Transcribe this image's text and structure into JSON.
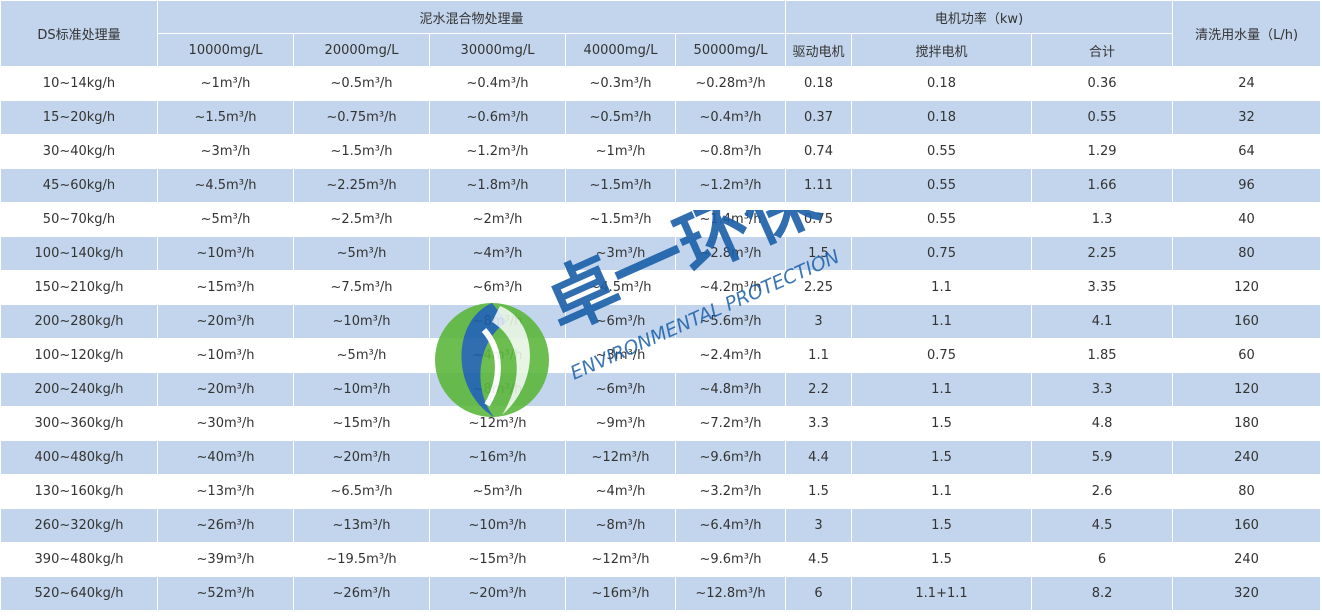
{
  "header": {
    "ds_label": "DS标准处理量",
    "mixture_label": "泥水混合物处理量",
    "motor_label": "电机功率（kw)",
    "wash_label": "清洗用水量（L/h)",
    "concentrations": [
      "10000mg/L",
      "20000mg/L",
      "30000mg/L",
      "40000mg/L",
      "50000mg/L"
    ],
    "motor_columns": [
      "驱动电机",
      "搅拌电机",
      "合计"
    ]
  },
  "rows": [
    [
      "10~14kg/h",
      "~1m³/h",
      "~0.5m³/h",
      "~0.4m³/h",
      "~0.3m³/h",
      "~0.28m³/h",
      "0.18",
      "0.18",
      "0.36",
      "24"
    ],
    [
      "15~20kg/h",
      "~1.5m³/h",
      "~0.75m³/h",
      "~0.6m³/h",
      "~0.5m³/h",
      "~0.4m³/h",
      "0.37",
      "0.18",
      "0.55",
      "32"
    ],
    [
      "30~40kg/h",
      "~3m³/h",
      "~1.5m³/h",
      "~1.2m³/h",
      "~1m³/h",
      "~0.8m³/h",
      "0.74",
      "0.55",
      "1.29",
      "64"
    ],
    [
      "45~60kg/h",
      "~4.5m³/h",
      "~2.25m³/h",
      "~1.8m³/h",
      "~1.5m³/h",
      "~1.2m³/h",
      "1.11",
      "0.55",
      "1.66",
      "96"
    ],
    [
      "50~70kg/h",
      "~5m³/h",
      "~2.5m³/h",
      "~2m³/h",
      "~1.5m³/h",
      "~1.4m³/h",
      "0.75",
      "0.55",
      "1.3",
      "40"
    ],
    [
      "100~140kg/h",
      "~10m³/h",
      "~5m³/h",
      "~4m³/h",
      "~3m³/h",
      "~2.8m³/h",
      "1.5",
      "0.75",
      "2.25",
      "80"
    ],
    [
      "150~210kg/h",
      "~15m³/h",
      "~7.5m³/h",
      "~6m³/h",
      "~4.5m³/h",
      "~4.2m³/h",
      "2.25",
      "1.1",
      "3.35",
      "120"
    ],
    [
      "200~280kg/h",
      "~20m³/h",
      "~10m³/h",
      "~8m³/h",
      "~6m³/h",
      "~5.6m³/h",
      "3",
      "1.1",
      "4.1",
      "160"
    ],
    [
      "100~120kg/h",
      "~10m³/h",
      "~5m³/h",
      "~4m³/h",
      "~3m³/h",
      "~2.4m³/h",
      "1.1",
      "0.75",
      "1.85",
      "60"
    ],
    [
      "200~240kg/h",
      "~20m³/h",
      "~10m³/h",
      "~8m³/h",
      "~6m³/h",
      "~4.8m³/h",
      "2.2",
      "1.1",
      "3.3",
      "120"
    ],
    [
      "300~360kg/h",
      "~30m³/h",
      "~15m³/h",
      "~12m³/h",
      "~9m³/h",
      "~7.2m³/h",
      "3.3",
      "1.5",
      "4.8",
      "180"
    ],
    [
      "400~480kg/h",
      "~40m³/h",
      "~20m³/h",
      "~16m³/h",
      "~12m³/h",
      "~9.6m³/h",
      "4.4",
      "1.5",
      "5.9",
      "240"
    ],
    [
      "130~160kg/h",
      "~13m³/h",
      "~6.5m³/h",
      "~5m³/h",
      "~4m³/h",
      "~3.2m³/h",
      "1.5",
      "1.1",
      "2.6",
      "80"
    ],
    [
      "260~320kg/h",
      "~26m³/h",
      "~13m³/h",
      "~10m³/h",
      "~8m³/h",
      "~6.4m³/h",
      "3",
      "1.5",
      "4.5",
      "160"
    ],
    [
      "390~480kg/h",
      "~39m³/h",
      "~19.5m³/h",
      "~15m³/h",
      "~12m³/h",
      "~9.6m³/h",
      "4.5",
      "1.5",
      "6",
      "240"
    ],
    [
      "520~640kg/h",
      "~52m³/h",
      "~26m³/h",
      "~20m³/h",
      "~16m³/h",
      "~12.8m³/h",
      "6",
      "1.1+1.1",
      "8.2",
      "320"
    ]
  ],
  "watermark": {
    "brand_cn": "卓一环保",
    "brand_en": "ENVIRONMENTAL PROTECTION"
  },
  "colors": {
    "header_bg": "#c3d5ec",
    "stripe_bg": "#c3d5ec",
    "brand_blue": "#1a5fa8",
    "brand_green": "#5cb83c"
  }
}
